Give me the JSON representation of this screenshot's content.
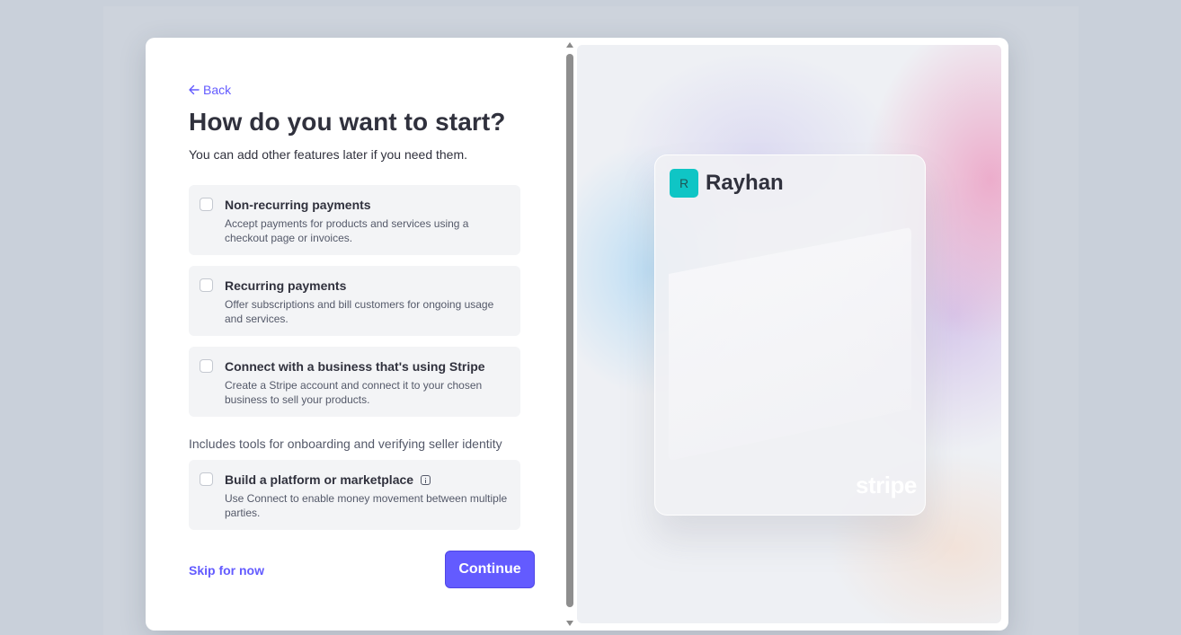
{
  "back": {
    "label": "Back"
  },
  "heading": {
    "title": "How do you want to start?",
    "subtitle": "You can add other features later if you need them."
  },
  "options": [
    {
      "title": "Non-recurring payments",
      "description": "Accept payments for products and services using a checkout page or invoices.",
      "checked": false
    },
    {
      "title": "Recurring payments",
      "description": "Offer subscriptions and bill customers for ongoing usage and services.",
      "checked": false
    },
    {
      "title": "Connect with a business that's using Stripe",
      "description": "Create a Stripe account and connect it to your chosen business to sell your products.",
      "checked": false
    }
  ],
  "section_note": "Includes tools for onboarding and verifying seller identity",
  "platform_option": {
    "title": "Build a platform or marketplace",
    "description": "Use Connect to enable money movement between multiple parties.",
    "checked": false,
    "icon": "info-icon"
  },
  "footer": {
    "skip_label": "Skip for now",
    "continue_label": "Continue"
  },
  "preview": {
    "avatar_letter": "R",
    "business_name": "Rayhan",
    "brand_logo": "stripe",
    "avatar_color": "#0fc5c5"
  },
  "colors": {
    "accent": "#635bff",
    "text": "#30313d",
    "muted": "#545969"
  }
}
